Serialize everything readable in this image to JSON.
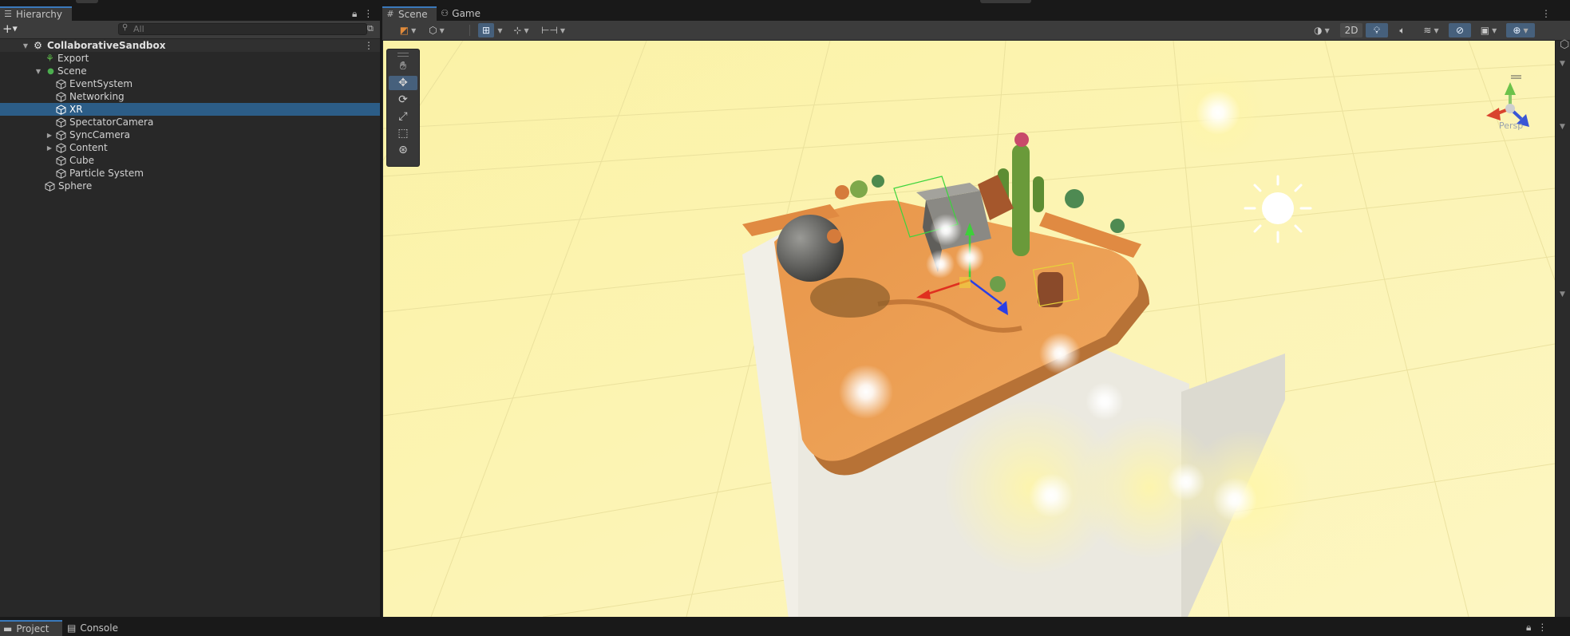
{
  "hierarchy": {
    "tab_label": "Hierarchy",
    "add_label": "+",
    "search_placeholder": "All",
    "root": "CollaborativeSandbox",
    "items": [
      {
        "label": "Export"
      },
      {
        "label": "Scene"
      },
      {
        "label": "EventSystem"
      },
      {
        "label": "Networking"
      },
      {
        "label": "XR",
        "selected": true
      },
      {
        "label": "SpectatorCamera"
      },
      {
        "label": "SyncCamera"
      },
      {
        "label": "Content"
      },
      {
        "label": "Cube"
      },
      {
        "label": "Particle System"
      },
      {
        "label": "Sphere"
      }
    ]
  },
  "scene": {
    "tabs": [
      {
        "label": "Scene"
      },
      {
        "label": "Game"
      }
    ],
    "toolbar": {
      "mode_2d": "2D"
    },
    "gizmo": {
      "projection": "Persp"
    }
  },
  "bottom": {
    "tabs": [
      {
        "label": "Project"
      },
      {
        "label": "Console"
      }
    ]
  },
  "colors": {
    "accent": "#3a79bb",
    "selection": "#2c5d87",
    "ground": "#fcf4b0",
    "platform": "#e58e45"
  }
}
